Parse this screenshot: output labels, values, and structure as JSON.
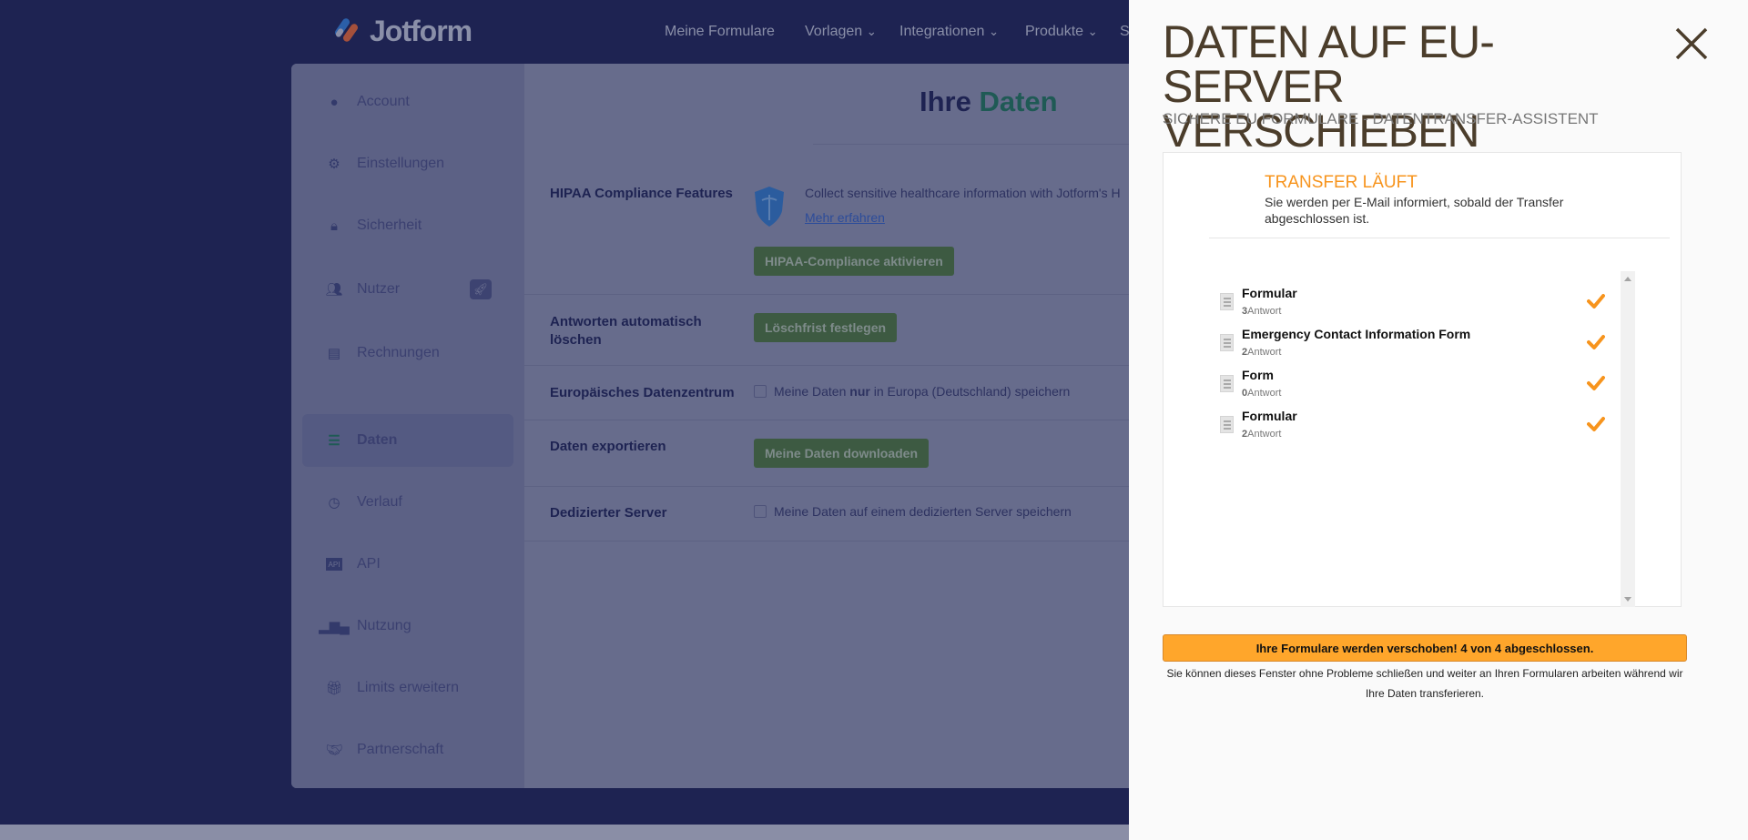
{
  "nav": {
    "logo": "Jotform",
    "items": [
      "Meine Formulare",
      "Vorlagen",
      "Integrationen",
      "Produkte",
      "S"
    ]
  },
  "sidebar": {
    "items": [
      {
        "label": "Account",
        "icon": "user-icon"
      },
      {
        "label": "Einstellungen",
        "icon": "gear-icon"
      },
      {
        "label": "Sicherheit",
        "icon": "lock-icon"
      },
      {
        "label": "Nutzer",
        "icon": "users-icon"
      },
      {
        "label": "Rechnungen",
        "icon": "invoice-icon"
      },
      {
        "label": "Daten",
        "icon": "database-icon",
        "active": true
      },
      {
        "label": "Verlauf",
        "icon": "history-icon"
      },
      {
        "label": "API",
        "icon": "api-icon"
      },
      {
        "label": "Nutzung",
        "icon": "bar-chart-icon"
      },
      {
        "label": "Limits erweitern",
        "icon": "gift-icon"
      },
      {
        "label": "Partnerschaft",
        "icon": "handshake-icon"
      }
    ]
  },
  "main": {
    "title_a": "Ihre",
    "title_b": "Daten",
    "hipaa": {
      "label": "HIPAA Compliance Features",
      "text": "Collect sensitive healthcare information with Jotform's H",
      "link": "Mehr erfahren",
      "button": "HIPAA-Compliance aktivieren"
    },
    "autodelete": {
      "label": "Antworten automatisch löschen",
      "button": "Löschfrist festlegen"
    },
    "eu": {
      "label": "Europäisches Datenzentrum",
      "text_a": "Meine Daten ",
      "text_b": "nur",
      "text_c": " in Europa (Deutschland) speichern"
    },
    "export": {
      "label": "Daten exportieren",
      "button": "Meine Daten downloaden"
    },
    "dedicated": {
      "label": "Dedizierter Server",
      "text": "Meine Daten auf einem dedizierten Server speichern"
    }
  },
  "panel": {
    "title": "DATEN AUF EU-SERVER VERSCHIEBEN",
    "subtitle": "SICHERE EU FORMULARE - DATENTRANSFER-ASSISTENT",
    "status_title": "TRANSFER LÄUFT",
    "status_desc": "Sie werden per E-Mail informiert, sobald der Transfer abgeschlossen ist.",
    "forms": [
      {
        "title": "Formular",
        "count": "3",
        "unit": "Antwort",
        "done": true
      },
      {
        "title": "Emergency Contact Information Form",
        "count": "2",
        "unit": "Antwort",
        "done": true
      },
      {
        "title": "Form",
        "count": "0",
        "unit": "Antwort",
        "done": true
      },
      {
        "title": "Formular",
        "count": "2",
        "unit": "Antwort",
        "done": true
      }
    ],
    "progress_text": "Ihre Formulare werden verschoben! 4 von 4 abgeschlossen.",
    "progress": {
      "done": 4,
      "total": 4
    },
    "note": "Sie können dieses Fenster ohne Probleme schließen und weiter an Ihren Formularen arbeiten während wir Ihre Daten transferieren.",
    "colors": {
      "accent": "#f7941d",
      "bar": "#ffa62b",
      "title": "#4b3d2b"
    }
  }
}
